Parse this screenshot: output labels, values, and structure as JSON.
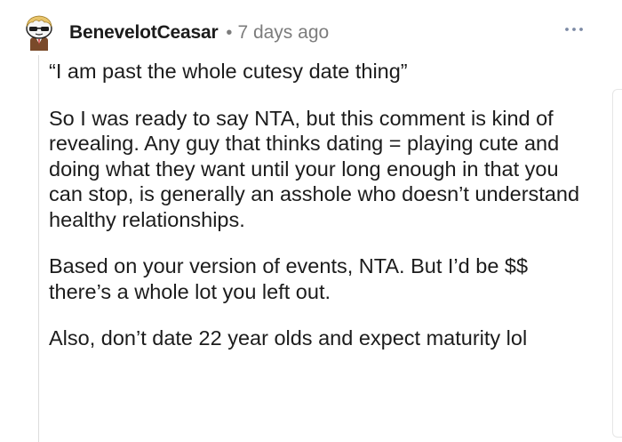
{
  "comment": {
    "author": "BenevelotCeasar",
    "separator": "•",
    "timestamp": "7 days ago",
    "avatar_icon": "snoo-avatar-icon",
    "more_icon": "more-options-icon",
    "paragraphs": [
      "“I am past the whole cutesy date thing”",
      "So I was ready to say NTA, but this comment is kind of revealing. Any guy that thinks dating = playing cute and doing what they want until your long enough in that you can stop, is generally an asshole who doesn’t understand healthy relationships.",
      "Based on your version of events, NTA. But I’d be $$ there’s a whole lot you left out.",
      "Also, don’t date 22 year olds and expect maturity lol"
    ]
  },
  "colors": {
    "text": "#1c1c1c",
    "meta": "#7c7c7c",
    "thread_line": "#dcdcdc"
  }
}
